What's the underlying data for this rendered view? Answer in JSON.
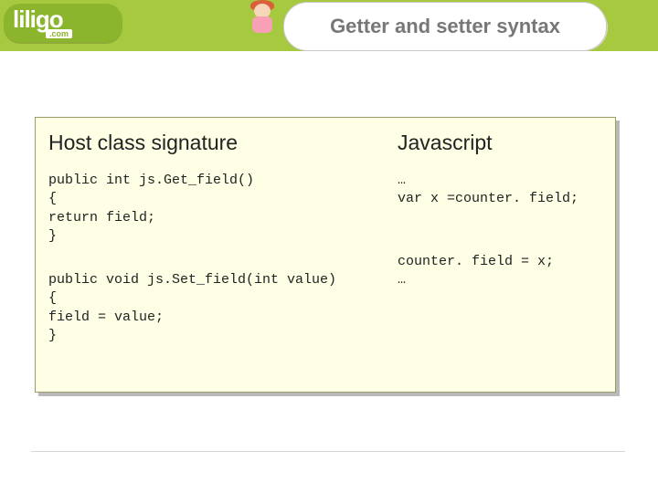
{
  "logo": {
    "text": "liligo",
    "sub": ".com"
  },
  "title": "Getter and setter syntax",
  "panel": {
    "left_head": "Host class signature",
    "right_head": "Javascript",
    "left_block1": "public int js.Get_field()\n{\nreturn field;\n}",
    "left_block2": "public void js.Set_field(int value)\n{\nfield = value;\n}",
    "right_block1": "…\nvar x =counter. field;",
    "right_block2": "counter. field = x;\n…"
  }
}
